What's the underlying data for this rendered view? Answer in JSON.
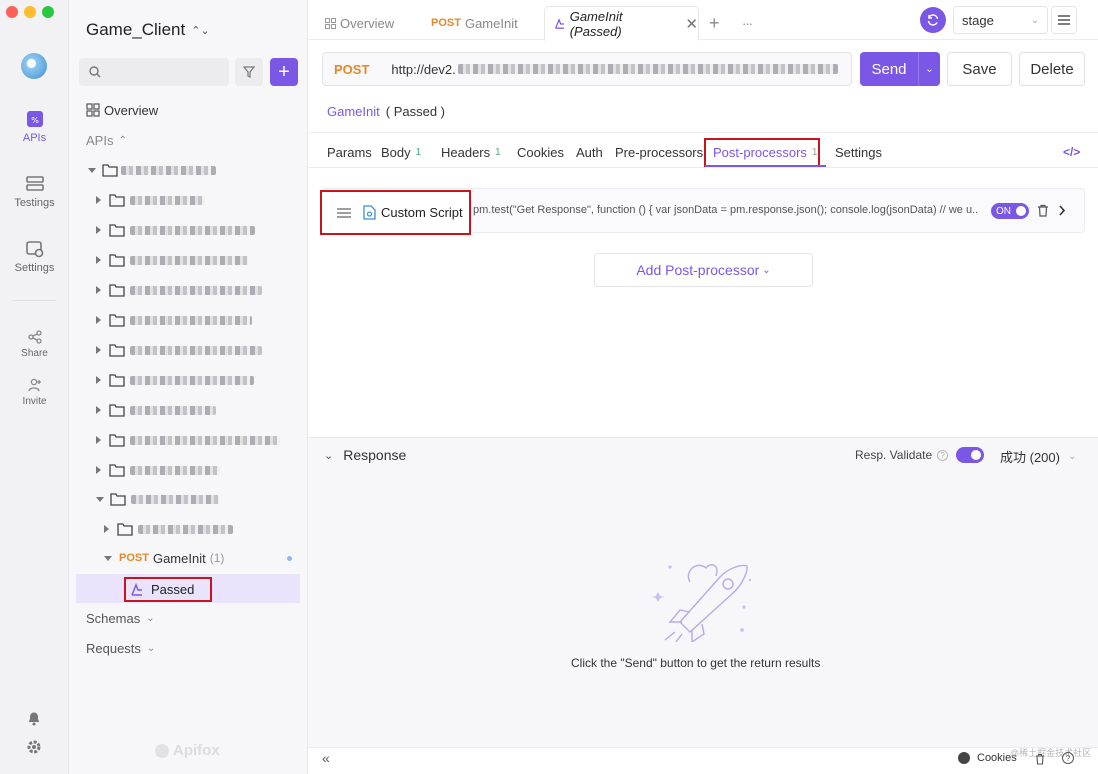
{
  "rail": {
    "items": [
      {
        "label": "APIs"
      },
      {
        "label": "Testings"
      },
      {
        "label": "Settings"
      },
      {
        "label": "Share"
      },
      {
        "label": "Invite"
      }
    ]
  },
  "sidebar": {
    "project": "Game_Client",
    "overview": "Overview",
    "apis_label": "APIs",
    "gameinit_method": "POST",
    "gameinit_name": "GameInit",
    "gameinit_count": "(1)",
    "passed": "Passed",
    "schemas": "Schemas",
    "requests": "Requests",
    "brand": "Apifox"
  },
  "tabs": {
    "overview": "Overview",
    "gameinit_method": "POST",
    "gameinit": "GameInit",
    "active": "GameInit (Passed)",
    "plus": "+",
    "more": "···"
  },
  "env": {
    "selected": "stage"
  },
  "request": {
    "method": "POST",
    "url": "http://dev2.",
    "send": "Send",
    "save": "Save",
    "delete": "Delete",
    "breadcrumb_api": "GameInit",
    "breadcrumb_case": "( Passed )"
  },
  "subtabs": {
    "params": "Params",
    "body": "Body",
    "body_count": "1",
    "headers": "Headers",
    "headers_count": "1",
    "cookies": "Cookies",
    "auth": "Auth",
    "pre": "Pre-processors",
    "post": "Post-processors",
    "post_count": "1",
    "settings": "Settings"
  },
  "processor": {
    "name": "Custom Script",
    "code": "pm.test(\"Get Response\", function () { var jsonData = pm.response.json(); console.log(jsonData) // we u...",
    "toggle": "ON",
    "add": "Add Post-processor"
  },
  "response": {
    "title": "Response",
    "validate": "Resp. Validate",
    "status": "成功 (200)",
    "empty": "Click the \"Send\" button to get the return results"
  },
  "footer": {
    "cookies": "Cookies",
    "watermark": "@稀土掘金技术社区"
  }
}
